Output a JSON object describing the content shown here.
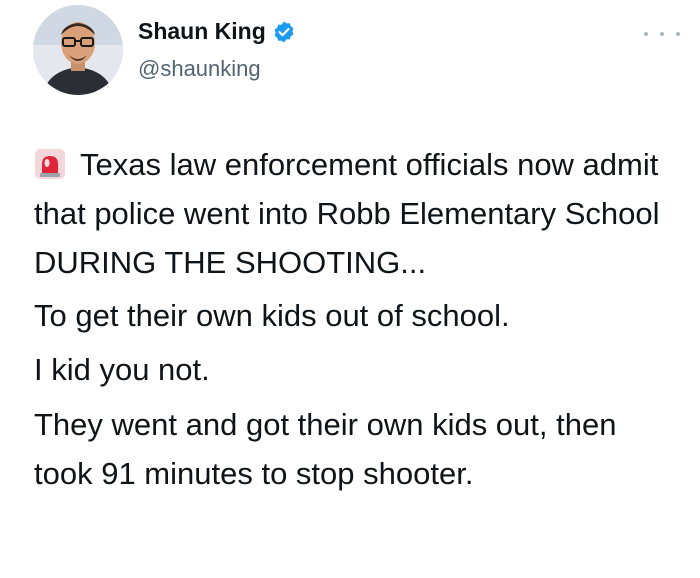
{
  "tweet": {
    "author_name": "Shaun King",
    "handle": "@shaunking",
    "verified": true,
    "icons": {
      "verified": "verified-badge-icon",
      "more": "more-options-icon",
      "siren": "rotating-light-emoji"
    },
    "paragraphs": [
      "Texas law enforcement officials now admit that police went into Robb Elementary School DURING THE SHOOTING...",
      "To get their own kids out of school.",
      "I kid you not.",
      "They went and got their own kids out, then took 91 minutes to stop shooter."
    ]
  },
  "colors": {
    "text": "#0f1419",
    "secondary": "#536471",
    "verified_blue": "#1d9bf0",
    "siren_red": "#e0243a"
  }
}
